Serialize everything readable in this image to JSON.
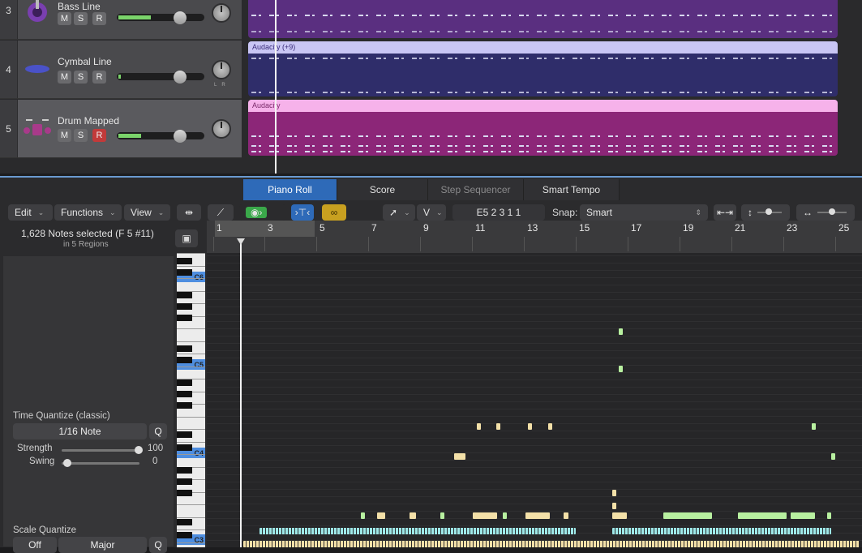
{
  "tracks": [
    {
      "num": "3",
      "name": "Bass Line",
      "m": "M",
      "s": "S",
      "r": "R",
      "rec": false,
      "icon": "bass-guitar-icon"
    },
    {
      "num": "4",
      "name": "Cymbal Line",
      "m": "M",
      "s": "S",
      "r": "R",
      "rec": false,
      "icon": "cymbal-icon"
    },
    {
      "num": "5",
      "name": "Drum Mapped",
      "m": "M",
      "s": "S",
      "r": "R",
      "rec": true,
      "icon": "drum-kit-icon"
    }
  ],
  "regions": [
    {
      "label": "",
      "color": "#5a2f80"
    },
    {
      "label": "Audacity (+9)",
      "color": "#2f2d6a",
      "head": "#c9c6f5"
    },
    {
      "label": "Audacity",
      "color": "#8c2678",
      "head": "#f6b2ea"
    }
  ],
  "tabs": {
    "piano_roll": "Piano Roll",
    "score": "Score",
    "step_sequencer": "Step Sequencer",
    "smart_tempo": "Smart Tempo"
  },
  "toolbar": {
    "edit": "Edit",
    "functions": "Functions",
    "view": "View",
    "pointer_mode": "V",
    "position": "E5  2 3 1 1",
    "snap_label": "Snap:",
    "snap_value": "Smart"
  },
  "info": {
    "selection": "1,628 Notes selected (F 5 #11)",
    "regions": "in 5 Regions"
  },
  "time_quantize": {
    "title": "Time Quantize (classic)",
    "value": "1/16 Note",
    "q": "Q",
    "strength_label": "Strength",
    "strength_value": "100",
    "swing_label": "Swing",
    "swing_value": "0"
  },
  "scale_quantize": {
    "title": "Scale Quantize",
    "off": "Off",
    "scale": "Major",
    "q": "Q"
  },
  "ruler": {
    "bars": [
      "1",
      "3",
      "5",
      "7",
      "9",
      "11",
      "13",
      "15",
      "17",
      "19",
      "21",
      "23",
      "25"
    ]
  },
  "keys": {
    "labels": [
      "C6",
      "C5",
      "C4",
      "C3"
    ]
  },
  "colors": {
    "accent": "#2e6ab8",
    "note_green": "#b8f0a0",
    "note_cream": "#f3e0a8",
    "note_cyan": "#9ee8e8",
    "record": "#c23a3a"
  }
}
